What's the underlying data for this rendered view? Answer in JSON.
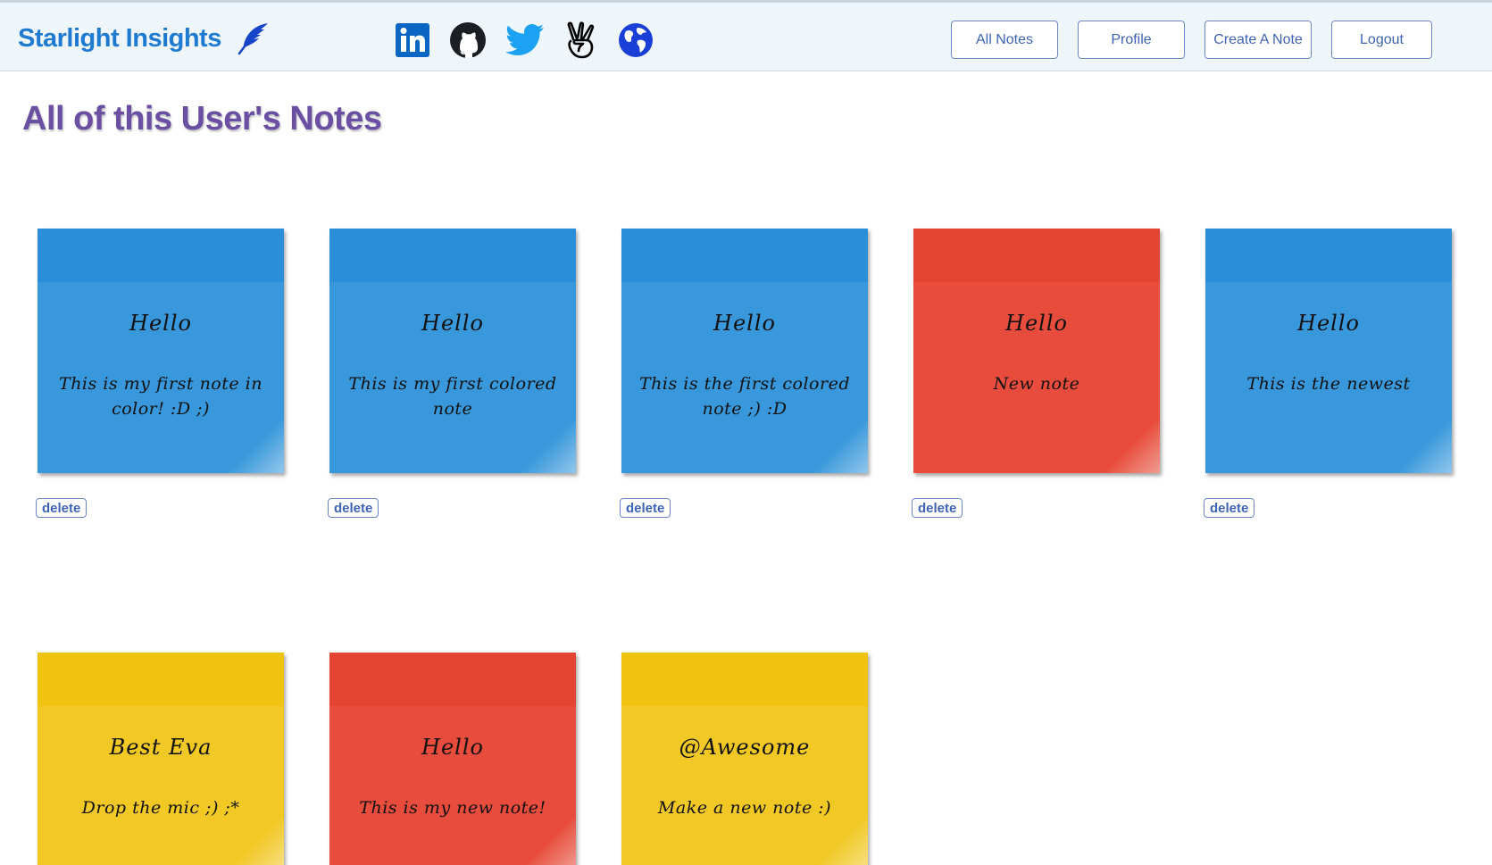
{
  "header": {
    "brand": "Starlight Insights",
    "brand_icon": "feather-icon",
    "socials": [
      {
        "name": "linkedin-icon",
        "color": "#0a66c2"
      },
      {
        "name": "github-icon",
        "color": "#1b1f23"
      },
      {
        "name": "twitter-icon",
        "color": "#1da1f2"
      },
      {
        "name": "angellist-icon",
        "color": "#000000"
      },
      {
        "name": "globe-icon",
        "color": "#1a3fd6"
      }
    ],
    "nav": {
      "all_notes": "All Notes",
      "profile": "Profile",
      "create_note": "Create A Note",
      "logout": "Logout"
    }
  },
  "page_title": "All of this User's Notes",
  "delete_label": "delete",
  "colors": {
    "blue": "#3898db",
    "red": "#e74c3c",
    "yellow": "#f1c824"
  },
  "notes": [
    {
      "color": "blue",
      "title": "Hello",
      "body": "This is my first note in color! :D ;)"
    },
    {
      "color": "blue",
      "title": "Hello",
      "body": "This is my first colored note"
    },
    {
      "color": "blue",
      "title": "Hello",
      "body": "This is the first colored note ;) :D"
    },
    {
      "color": "red",
      "title": "Hello",
      "body": "New note"
    },
    {
      "color": "blue",
      "title": "Hello",
      "body": "This is the newest"
    },
    {
      "color": "yellow",
      "title": "Best Eva",
      "body": "Drop the mic ;) ;*"
    },
    {
      "color": "red",
      "title": "Hello",
      "body": "This is my new note!"
    },
    {
      "color": "yellow",
      "title": "@Awesome",
      "body": "Make a new note :)"
    }
  ]
}
